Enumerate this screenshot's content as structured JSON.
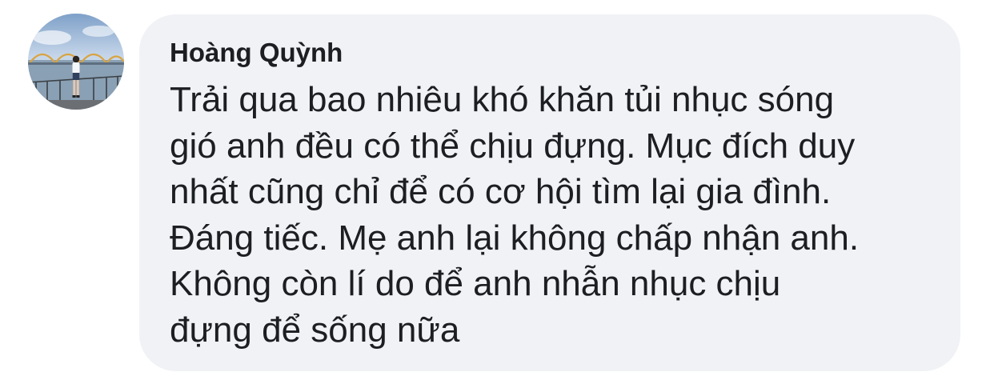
{
  "comment": {
    "author": "Hoàng Quỳnh",
    "lines": [
      "Trải qua bao nhiêu khó khăn tủi nhục sóng",
      "gió anh đều có thể chịu đựng. Mục đích duy",
      "nhất cũng chỉ để có cơ hội tìm lại gia đình.",
      "Đáng tiếc. Mẹ anh lại không chấp nhận anh.",
      "Không còn lí do để anh nhẫn nhục chịu",
      "đựng để sống nữa"
    ]
  },
  "colors": {
    "bubble_background": "#f0f2f5",
    "text": "#1c1e21",
    "page_background": "#ffffff"
  }
}
